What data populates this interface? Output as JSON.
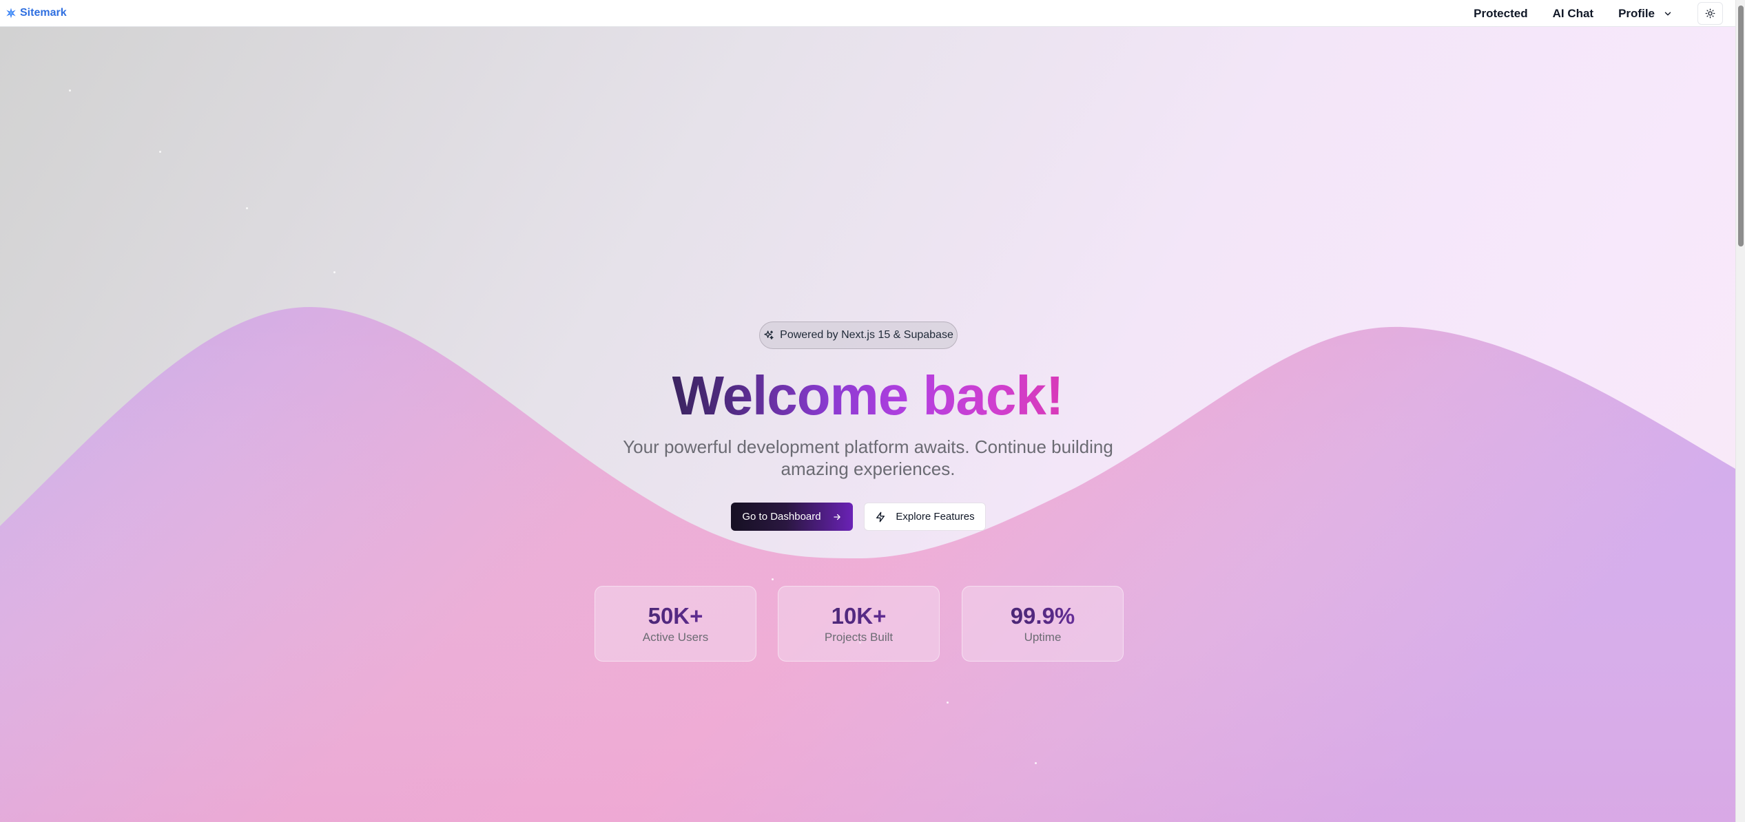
{
  "navbar": {
    "brand": "Sitemark",
    "links": [
      "Protected",
      "AI Chat"
    ],
    "profile_label": "Profile"
  },
  "hero": {
    "badge": "Powered by Next.js 15 & Supabase",
    "headline": "Welcome back!",
    "subtitle": "Your powerful development platform awaits. Continue building amazing experiences.",
    "primary_button": "Go to Dashboard",
    "secondary_button": "Explore Features"
  },
  "stats": [
    {
      "value": "50K+",
      "label": "Active Users"
    },
    {
      "value": "10K+",
      "label": "Projects Built"
    },
    {
      "value": "99.9%",
      "label": "Uptime"
    }
  ],
  "colors": {
    "brand": "#2f6fe0",
    "headline_start": "#3b2460",
    "headline_end": "#d83ab8",
    "wave_purple": "#c9a6ec",
    "wave_pink": "#eeaad6"
  },
  "icons": {
    "brand": "sitemark-logo-icon",
    "profile": "chevron-down-icon",
    "theme": "sun-icon",
    "badge": "sparkles-icon",
    "primary": "arrow-right-icon",
    "secondary": "zap-icon"
  }
}
